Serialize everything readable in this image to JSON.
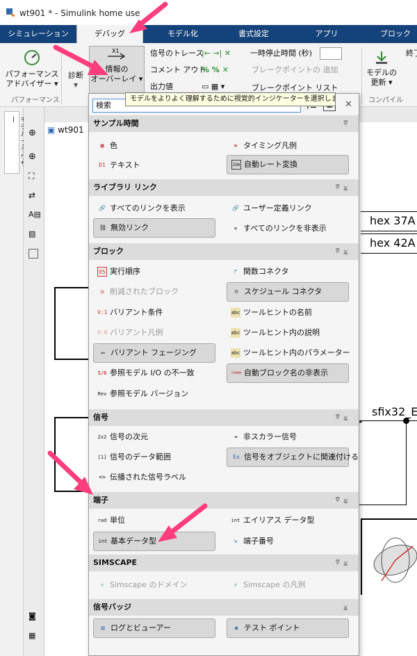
{
  "window": {
    "title": "wt901 * - Simulink home use"
  },
  "tabs": [
    {
      "label": "シミュレーション"
    },
    {
      "label": "デバッグ"
    },
    {
      "label": "モデル化"
    },
    {
      "label": "書式設定"
    },
    {
      "label": "アプリ"
    },
    {
      "label": "ブロック"
    }
  ],
  "ribbon": {
    "perf_advisor": "パフォーマンス\nアドバイザー ▾",
    "perf_group": "パフォーマンス",
    "diagnose": "診断",
    "info_overlay": "情報の\nオーバーレイ ▾",
    "signal_trace": "信号のトレース",
    "comment_out": "コメント アウト",
    "output_value": "出力値",
    "pause_time_label": "一時停止時間 (秒)",
    "breakpoint_add": "ブレークポイントの 追加",
    "breakpoint_list": "ブレークポイント リスト",
    "model_update": "モデルの\n更新 ▾",
    "compile_group": "コンパイル",
    "end_label": "終了"
  },
  "tooltip": "モデルをよりよく理解するために視覚的インジケーターを選択します",
  "search": {
    "placeholder": "検索"
  },
  "left": {
    "model_browser": "モデル ブラウザー",
    "tab_name": "wt901"
  },
  "sections": {
    "sample_time": {
      "title": "サンプル時間",
      "items": {
        "color": "色",
        "text": "テキスト",
        "timing_legend": "タイミング凡例",
        "auto_rate": "自動レート変換"
      }
    },
    "library_link": {
      "title": "ライブラリ リンク",
      "items": {
        "show_all": "すべてのリンクを表示",
        "user_defined": "ユーザー定義リンク",
        "disabled_link": "無効リンク",
        "hide_all": "すべてのリンクを非表示"
      }
    },
    "block": {
      "title": "ブロック",
      "items": {
        "exec_order": "実行順序",
        "removed_block": "削減されたブロック",
        "variant_cond": "バリアント条件",
        "variant_legend": "バリアント凡例",
        "variant_fading": "バリアント フェージング",
        "ref_io": "参照モデル I/O の不一致",
        "ref_version": "参照モデル バージョン",
        "func_conn": "関数コネクタ",
        "sched_conn": "スケジュール コネクタ",
        "tip_name": "ツールヒントの名前",
        "tip_desc": "ツールヒント内の説明",
        "tip_param": "ツールヒント内のパラメーター",
        "hide_auto_name": "自動ブロック名の非表示"
      }
    },
    "signal": {
      "title": "信号",
      "items": {
        "dimension": "信号の次元",
        "data_range": "信号のデータ範囲",
        "prop_label": "伝播された信号ラベル",
        "nonscalar": "非スカラー信号",
        "obj_assoc": "信号をオブジェクトに関連付ける"
      }
    },
    "port": {
      "title": "端子",
      "items": {
        "unit": "単位",
        "base_type": "基本データ型",
        "alias_type": "エイリアス データ型",
        "port_number": "端子番号"
      }
    },
    "simscape": {
      "title": "SIMSCAPE",
      "items": {
        "domain": "Simscape のドメイン",
        "legend": "Simscape の凡例"
      }
    },
    "badges": {
      "title": "信号バッジ",
      "items": {
        "log_viewer": "ログとビューアー",
        "test_point": "テスト ポイント"
      }
    }
  },
  "model": {
    "hex1": "hex 37A",
    "hex2": "hex 42A",
    "signal": "sfix32_E"
  },
  "colors": {
    "tabbar": "#14427a",
    "accent_arrow": "#ff3d7f",
    "section_bg": "#dcdcdc"
  }
}
